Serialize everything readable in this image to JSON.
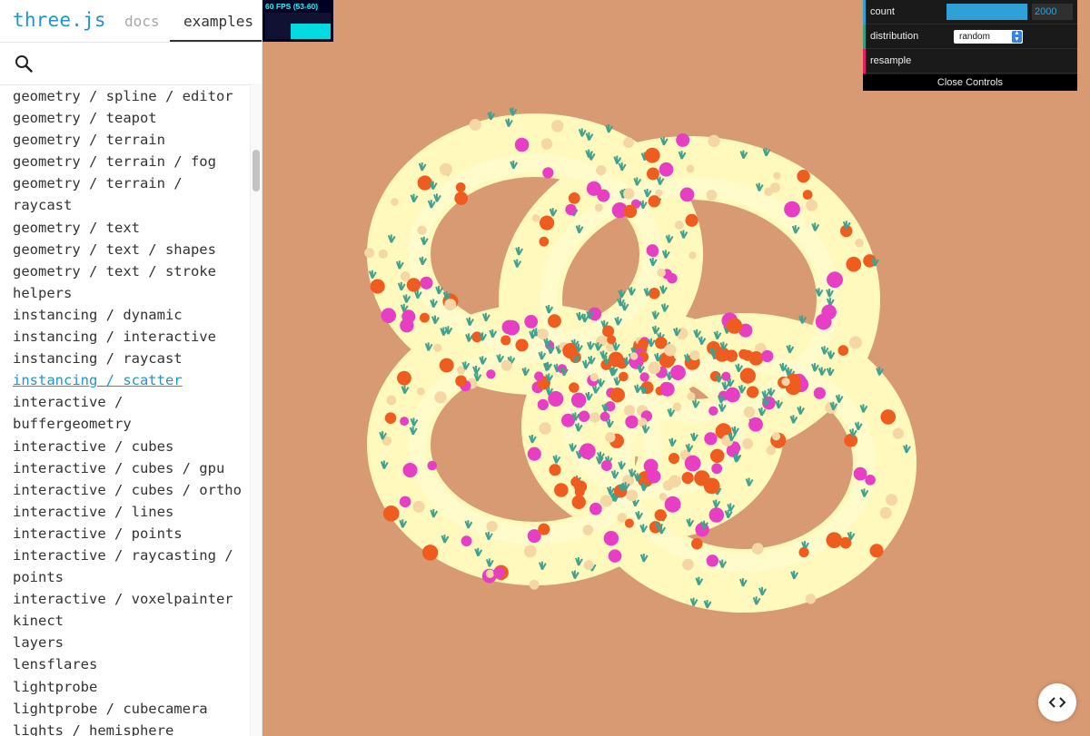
{
  "sidebar": {
    "brand": "three.js",
    "tabs": [
      {
        "label": "docs",
        "active": false
      },
      {
        "label": "examples",
        "active": true
      }
    ],
    "search_icon": "search-icon",
    "items": [
      "geometry / spline / editor",
      "geometry / teapot",
      "geometry / terrain",
      "geometry / terrain / fog",
      "geometry / terrain /\nraycast",
      "geometry / text",
      "geometry / text / shapes",
      "geometry / text / stroke",
      "helpers",
      "instancing / dynamic",
      "instancing / interactive",
      "instancing / raycast",
      "instancing / scatter",
      "interactive /\nbuffergeometry",
      "interactive / cubes",
      "interactive / cubes / gpu",
      "interactive / cubes / ortho",
      "interactive / lines",
      "interactive / points",
      "interactive / raycasting /\npoints",
      "interactive / voxelpainter",
      "kinect",
      "layers",
      "lensflares",
      "lightprobe",
      "lightprobe / cubecamera",
      "lights / hemisphere"
    ],
    "active_item": "instancing / scatter"
  },
  "stats": {
    "text": "60 FPS (53-60)"
  },
  "gui": {
    "count_label": "count",
    "count_value": "2000",
    "count_fill": 0.99,
    "distribution_label": "distribution",
    "distribution_value": "random",
    "resample_label": "resample",
    "close_label": "Close Controls"
  },
  "colors": {
    "background": "#d89a73",
    "link": "#2194ce",
    "gui_slider": "#2fa1d6"
  },
  "view_source_icon": "code-icon"
}
